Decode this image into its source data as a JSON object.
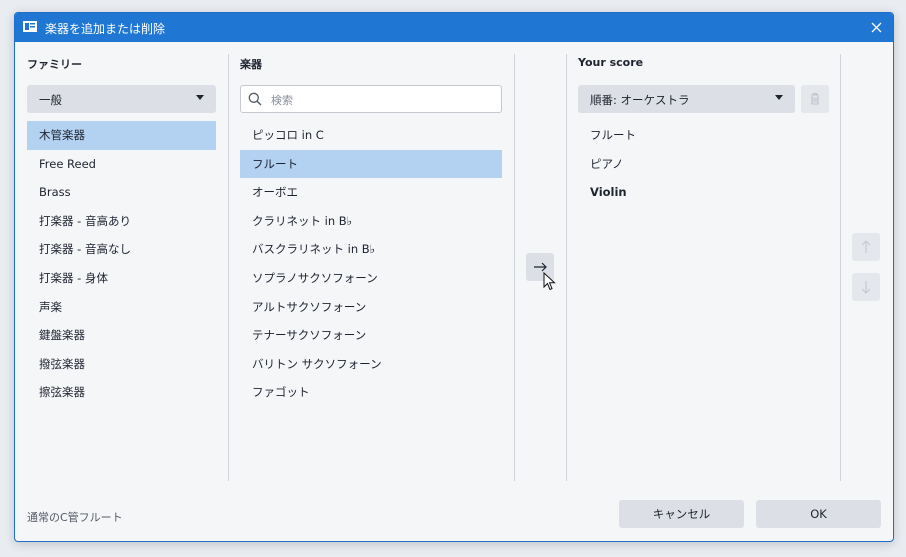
{
  "window": {
    "title": "楽器を追加または削除"
  },
  "family": {
    "heading": "ファミリー",
    "dropdown_value": "一般",
    "items": [
      {
        "label": "木管楽器",
        "selected": true
      },
      {
        "label": "Free Reed",
        "selected": false
      },
      {
        "label": "Brass",
        "selected": false
      },
      {
        "label": "打楽器 - 音高あり",
        "selected": false
      },
      {
        "label": "打楽器 - 音高なし",
        "selected": false
      },
      {
        "label": "打楽器 - 身体",
        "selected": false
      },
      {
        "label": "声楽",
        "selected": false
      },
      {
        "label": "鍵盤楽器",
        "selected": false
      },
      {
        "label": "撥弦楽器",
        "selected": false
      },
      {
        "label": "擦弦楽器",
        "selected": false
      }
    ]
  },
  "instruments": {
    "heading": "楽器",
    "search_placeholder": "検索",
    "items": [
      {
        "label": "ピッコロ in C",
        "selected": false
      },
      {
        "label": "フルート",
        "selected": true
      },
      {
        "label": "オーボエ",
        "selected": false
      },
      {
        "label": "クラリネット in B♭",
        "selected": false
      },
      {
        "label": "バスクラリネット in B♭",
        "selected": false
      },
      {
        "label": "ソプラノサクソフォーン",
        "selected": false
      },
      {
        "label": "アルトサクソフォーン",
        "selected": false
      },
      {
        "label": "テナーサクソフォーン",
        "selected": false
      },
      {
        "label": "バリトン サクソフォーン",
        "selected": false
      },
      {
        "label": "ファゴット",
        "selected": false
      }
    ]
  },
  "add_button": {
    "label": "→"
  },
  "score": {
    "heading": "Your score",
    "order_value": "順番: オーケストラ",
    "items": [
      {
        "label": "フルート",
        "bold": false
      },
      {
        "label": "ピアノ",
        "bold": false
      },
      {
        "label": "Violin",
        "bold": true
      }
    ]
  },
  "footer": {
    "status": "通常のC管フルート",
    "cancel_label": "キャンセル",
    "ok_label": "OK"
  },
  "colors": {
    "titlebar": "#1f76d3",
    "selection": "#b3d1f0",
    "button": "#dcdfe5"
  }
}
